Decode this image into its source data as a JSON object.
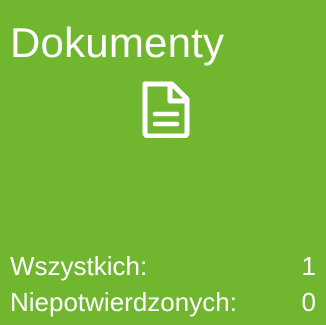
{
  "tile": {
    "title": "Dokumenty",
    "icon": "document-icon",
    "background_color": "#70b62e",
    "text_color": "#ffffff"
  },
  "stats": [
    {
      "label": "Wszystkich:",
      "value": "1"
    },
    {
      "label": "Niepotwierdzonych:",
      "value": "0"
    }
  ]
}
